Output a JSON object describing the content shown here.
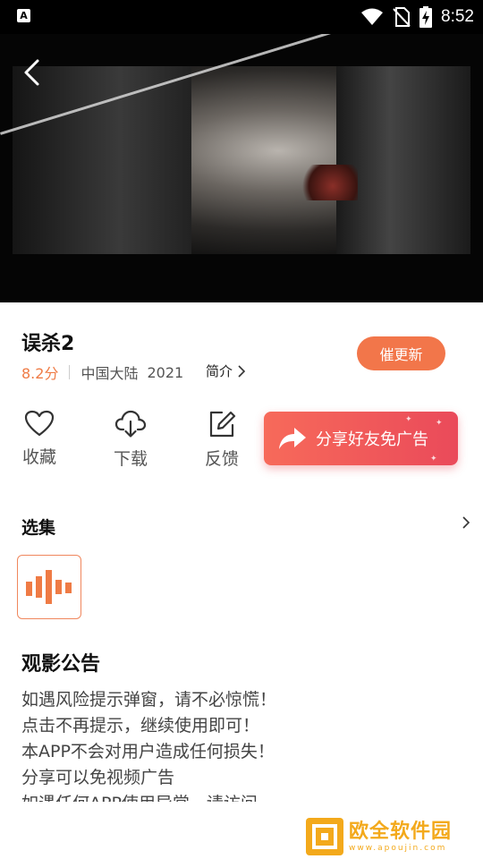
{
  "status_bar": {
    "time": "8:52",
    "icons": [
      "app-notification-icon",
      "wifi-icon",
      "no-sim-icon",
      "battery-charging-icon"
    ]
  },
  "video": {
    "back_icon": "chevron-left-icon"
  },
  "movie": {
    "title": "误杀2",
    "score": "8.2分",
    "region": "中国大陆",
    "year": "2021",
    "intro_label": "简介"
  },
  "urge_update_label": "催更新",
  "actions": {
    "favorite_label": "收藏",
    "download_label": "下载",
    "feedback_label": "反馈"
  },
  "share_banner": {
    "label": "分享好友免广告"
  },
  "episodes": {
    "title": "选集"
  },
  "notice": {
    "title": "观影公告",
    "lines": [
      "如遇风险提示弹窗，请不必惊慌！",
      "点击不再提示，继续使用即可！",
      "本APP不会对用户造成任何损失！",
      "分享可以免视频广告",
      "如遇任何APP使用异常，请访问"
    ]
  },
  "watermark": {
    "brand": "欧全软件园",
    "url": "www.apoujin.com"
  },
  "colors": {
    "accent": "#f2764a",
    "score": "#ef7b45",
    "share_banner": "#ea4a5a"
  }
}
